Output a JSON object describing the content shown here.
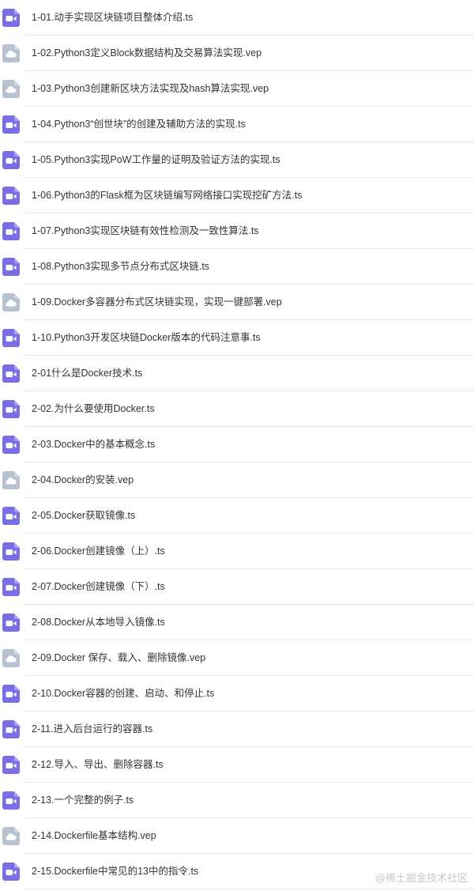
{
  "colors": {
    "video_icon": "#7a6ee6",
    "cloud_icon": "#b7c2d0",
    "text": "#333333",
    "divider": "#e8e8e8",
    "watermark": "#c7c7c7"
  },
  "files": [
    {
      "name": "1-01.动手实现区块链项目整体介绍.ts",
      "icon": "video-file-icon"
    },
    {
      "name": "1-02.Python3定义Block数据结构及交易算法实现.vep",
      "icon": "cloud-file-icon"
    },
    {
      "name": "1-03.Python3创建新区块方法实现及hash算法实现.vep",
      "icon": "cloud-file-icon"
    },
    {
      "name": "1-04.Python3“创世块”的创建及辅助方法的实现.ts",
      "icon": "video-file-icon"
    },
    {
      "name": "1-05.Python3实现PoW工作量的证明及验证方法的实现.ts",
      "icon": "video-file-icon"
    },
    {
      "name": "1-06.Python3的Flask框为区块链编写网络接口实现挖矿方法.ts",
      "icon": "video-file-icon"
    },
    {
      "name": "1-07.Python3实现区块链有效性检测及一致性算法.ts",
      "icon": "video-file-icon"
    },
    {
      "name": "1-08.Python3实现多节点分布式区块链.ts",
      "icon": "video-file-icon"
    },
    {
      "name": "1-09.Docker多容器分布式区块链实现，实现一键部署.vep",
      "icon": "cloud-file-icon"
    },
    {
      "name": "1-10.Python3开发区块链Docker版本的代码注意事.ts",
      "icon": "video-file-icon"
    },
    {
      "name": "2-01什么是Docker技术.ts",
      "icon": "video-file-icon"
    },
    {
      "name": "2-02.为什么要使用Docker.ts",
      "icon": "video-file-icon"
    },
    {
      "name": "2-03.Docker中的基本概念.ts",
      "icon": "video-file-icon"
    },
    {
      "name": "2-04.Docker的安装.vep",
      "icon": "cloud-file-icon"
    },
    {
      "name": "2-05.Docker获取镜像.ts",
      "icon": "video-file-icon"
    },
    {
      "name": "2-06.Docker创建镜像（上）.ts",
      "icon": "video-file-icon"
    },
    {
      "name": "2-07.Docker创建镜像（下）.ts",
      "icon": "video-file-icon"
    },
    {
      "name": "2-08.Docker从本地导入镜像.ts",
      "icon": "video-file-icon"
    },
    {
      "name": "2-09.Docker 保存、载入、删除镜像.vep",
      "icon": "cloud-file-icon"
    },
    {
      "name": "2-10.Docker容器的创建、启动、和停止.ts",
      "icon": "video-file-icon"
    },
    {
      "name": "2-11.进入后台运行的容器.ts",
      "icon": "video-file-icon"
    },
    {
      "name": "2-12.导入、导出、删除容器.ts",
      "icon": "video-file-icon"
    },
    {
      "name": "2-13.一个完整的例子.ts",
      "icon": "video-file-icon"
    },
    {
      "name": "2-14.Dockerfile基本结构.vep",
      "icon": "cloud-file-icon"
    },
    {
      "name": "2-15.Dockerfile中常见的13中的指令.ts",
      "icon": "video-file-icon"
    }
  ],
  "watermark": "@稀土掘金技术社区"
}
